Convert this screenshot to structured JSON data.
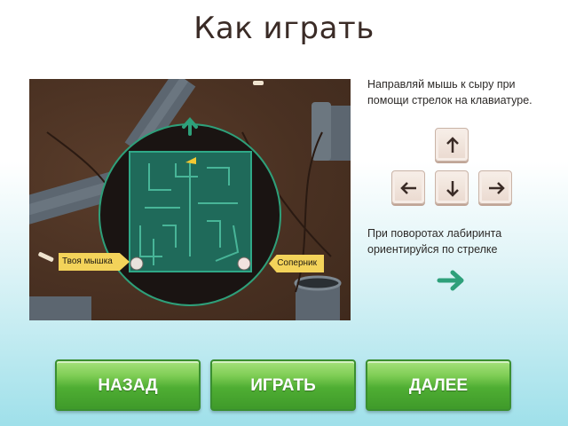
{
  "title": "Как играть",
  "instructions": {
    "keys_text": "Направляй мышь к сыру при помощи стрелок на клавиатуре.",
    "rotation_text": "При поворотах лабиринта ориентируйся по стрелке"
  },
  "game_preview": {
    "your_mouse_label": "Твоя мышка",
    "rival_label": "Соперник"
  },
  "keys": {
    "up": "arrow-up-key",
    "left": "arrow-left-key",
    "down": "arrow-down-key",
    "right": "arrow-right-key"
  },
  "buttons": {
    "back": "НАЗАД",
    "play": "ИГРАТЬ",
    "next": "ДАЛЕЕ"
  },
  "colors": {
    "accent_green": "#3f9a2a",
    "maze_green": "#1f6a5a",
    "hint_arrow": "#2ea07a",
    "label_yellow": "#f3d35a"
  }
}
